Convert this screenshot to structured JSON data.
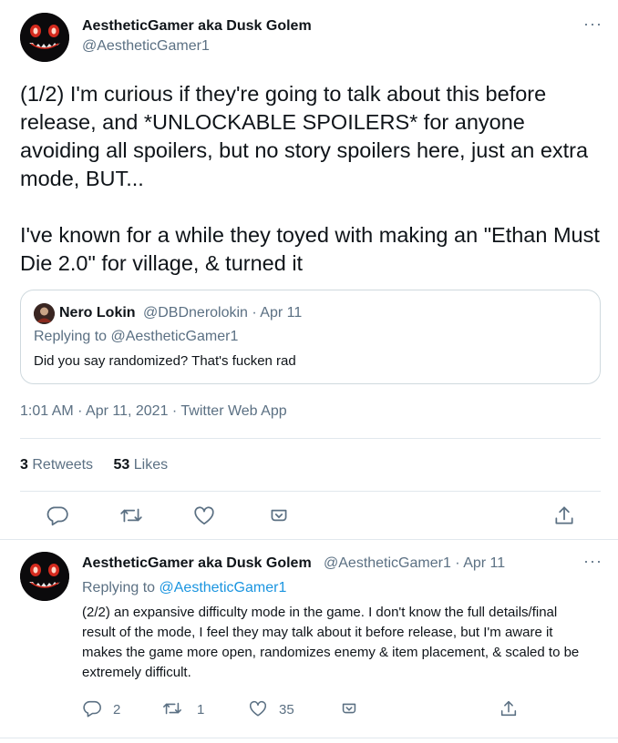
{
  "main_tweet": {
    "author_name": "AestheticGamer aka Dusk Golem",
    "author_handle": "@AestheticGamer1",
    "more_label": "···",
    "text": "(1/2) I'm curious if they're going to talk about this before release, and *UNLOCKABLE SPOILERS* for anyone avoiding all spoilers, but no story spoilers here, just an extra mode, BUT...\n\nI've known for a while they toyed with making an \"Ethan Must Die 2.0\" for village, & turned it",
    "quoted": {
      "author_name": "Nero Lokin",
      "meta": "@DBDnerolokin · Apr 11",
      "replying_to": "Replying to @AestheticGamer1",
      "text": "Did you say randomized? That's fucken rad"
    },
    "timestamp": "1:01 AM · Apr 11, 2021 · Twitter Web App",
    "retweets_count": "3",
    "retweets_label": "Retweets",
    "likes_count": "53",
    "likes_label": "Likes"
  },
  "reply_tweet": {
    "author_name": "AestheticGamer aka Dusk Golem",
    "meta": "@AestheticGamer1 · Apr 11",
    "more_label": "···",
    "replying_prefix": "Replying to ",
    "replying_handle": "@AestheticGamer1",
    "text": "(2/2) an expansive difficulty mode in the game. I don't know the full details/final result of the mode, I feel they may talk about it before release, but I'm aware it makes the game more open, randomizes enemy & item placement, & scaled to be extremely difficult.",
    "reply_count": "2",
    "retweet_count": "1",
    "like_count": "35"
  },
  "icons": {
    "reply": "reply-icon",
    "retweet": "retweet-icon",
    "like": "heart-icon",
    "save": "save-icon",
    "share": "share-icon"
  },
  "colors": {
    "text_primary": "#0f1419",
    "text_secondary": "#5b7083",
    "link": "#1b95e0",
    "border": "#e1e8ed",
    "icon": "#5b7083"
  }
}
